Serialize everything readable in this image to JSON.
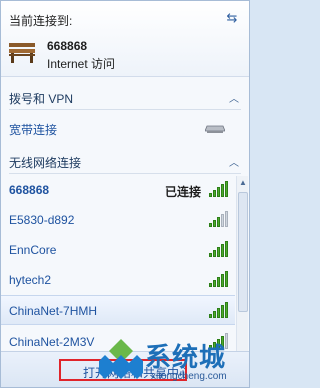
{
  "header": {
    "title": "当前连接到:",
    "network_name": "668868",
    "network_access": "Internet 访问",
    "refresh_icon": "refresh-icon",
    "bench_icon": "bench-icon"
  },
  "sections": {
    "dialup": {
      "label": "拨号和 VPN"
    },
    "wireless": {
      "label": "无线网络连接"
    }
  },
  "dialup_items": [
    {
      "name": "宽带连接",
      "icon": "drive-icon"
    }
  ],
  "wireless_items": [
    {
      "name": "668868",
      "status": "已连接",
      "signal": 5
    },
    {
      "name": "E5830-d892",
      "status": "",
      "signal": 3
    },
    {
      "name": "EnnCore",
      "status": "",
      "signal": 5
    },
    {
      "name": "hytech2",
      "status": "",
      "signal": 5
    },
    {
      "name": "ChinaNet-7HMH",
      "status": "",
      "signal": 5
    },
    {
      "name": "ChinaNet-2M3V",
      "status": "",
      "signal": 4
    }
  ],
  "footer": {
    "open_link": "打开网络和共享中心"
  },
  "watermark": {
    "text": "系统城",
    "url": "xitongcheng.com"
  },
  "colors": {
    "accent": "#1f53a0",
    "signal": "#4caa2a",
    "highlight": "#e0242a"
  }
}
